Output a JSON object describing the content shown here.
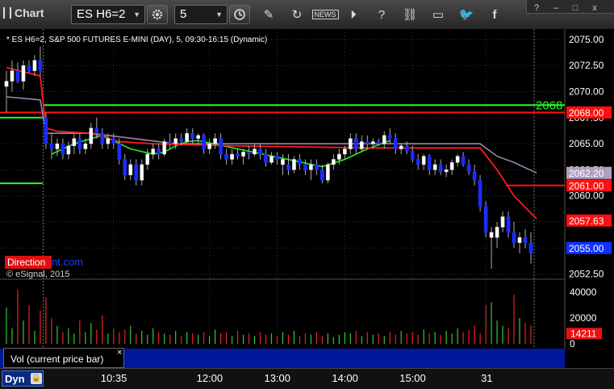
{
  "toolbar": {
    "app_title": "Chart",
    "symbol_value": "ES H6=2",
    "interval_value": "5"
  },
  "window_controls": [
    "?",
    "–",
    "□",
    "x"
  ],
  "chart_header": "* ES H6=2, S&P 500 FUTURES E-MINI (DAY), 5, 09:30-16:15 (Dynamic)",
  "watermark": {
    "part1": "Direction",
    "part2": "nt.com"
  },
  "copyright": "© eSignal, 2015",
  "price_labels": [
    {
      "value": 2068.0,
      "text": "2068.00",
      "color": "#ff1010"
    },
    {
      "value": 2062.2,
      "text": "2062.20",
      "color": "#b0a0c0"
    },
    {
      "value": 2061.0,
      "text": "2061.00",
      "color": "#ff1010"
    },
    {
      "value": 2057.63,
      "text": "2057.63",
      "color": "#ff1010"
    },
    {
      "value": 2055.0,
      "text": "2055.00",
      "color": "#1030ff"
    }
  ],
  "level_label": {
    "value": 2068.7,
    "text": "2068",
    "color": "#22ff22"
  },
  "volume_label": "Vol (current price bar)",
  "volume_last_label": "14211",
  "dyn_button": "Dyn",
  "chart_data": {
    "type": "candlestick",
    "price_axis": {
      "ticks": [
        "2075.00",
        "2072.50",
        "2070.00",
        "2067.50",
        "2065.00",
        "2062.50",
        "2060.00",
        "2057.50",
        "2055.00",
        "2052.50"
      ],
      "ylim": [
        2052.0,
        2076.0
      ]
    },
    "time_axis": {
      "ticks": [
        "10:35",
        "12:00",
        "13:00",
        "14:00",
        "15:00",
        "31"
      ]
    },
    "volume_axis": {
      "ticks": [
        "40000",
        "20000",
        "0"
      ],
      "ylim": [
        0,
        45000
      ]
    },
    "candles": [
      {
        "o": 2070.5,
        "h": 2072.0,
        "l": 2068.0,
        "c": 2071.0,
        "up": true
      },
      {
        "o": 2071.0,
        "h": 2073.0,
        "l": 2070.0,
        "c": 2072.0,
        "up": true
      },
      {
        "o": 2072.0,
        "h": 2072.8,
        "l": 2070.8,
        "c": 2071.0,
        "up": false
      },
      {
        "o": 2071.0,
        "h": 2073.0,
        "l": 2070.2,
        "c": 2072.5,
        "up": true
      },
      {
        "o": 2072.5,
        "h": 2073.0,
        "l": 2071.8,
        "c": 2072.0,
        "up": false
      },
      {
        "o": 2072.0,
        "h": 2073.5,
        "l": 2071.5,
        "c": 2073.0,
        "up": true
      },
      {
        "o": 2073.0,
        "h": 2074.3,
        "l": 2071.5,
        "c": 2072.0,
        "up": false
      },
      {
        "o": 2067.5,
        "h": 2068.0,
        "l": 2064.5,
        "c": 2065.0,
        "up": false
      },
      {
        "o": 2065.0,
        "h": 2066.0,
        "l": 2063.5,
        "c": 2064.5,
        "up": false
      },
      {
        "o": 2064.5,
        "h": 2065.5,
        "l": 2063.8,
        "c": 2065.0,
        "up": true
      },
      {
        "o": 2065.0,
        "h": 2065.5,
        "l": 2063.5,
        "c": 2064.0,
        "up": false
      },
      {
        "o": 2064.0,
        "h": 2065.2,
        "l": 2063.5,
        "c": 2064.8,
        "up": true
      },
      {
        "o": 2064.8,
        "h": 2066.0,
        "l": 2064.0,
        "c": 2065.5,
        "up": true
      },
      {
        "o": 2065.5,
        "h": 2066.0,
        "l": 2064.0,
        "c": 2064.5,
        "up": false
      },
      {
        "o": 2064.5,
        "h": 2065.5,
        "l": 2064.0,
        "c": 2065.0,
        "up": true
      },
      {
        "o": 2065.0,
        "h": 2067.0,
        "l": 2064.5,
        "c": 2066.5,
        "up": true
      },
      {
        "o": 2066.5,
        "h": 2067.5,
        "l": 2065.5,
        "c": 2066.0,
        "up": false
      },
      {
        "o": 2066.0,
        "h": 2066.5,
        "l": 2064.5,
        "c": 2065.0,
        "up": false
      },
      {
        "o": 2065.0,
        "h": 2066.0,
        "l": 2064.5,
        "c": 2065.5,
        "up": true
      },
      {
        "o": 2065.5,
        "h": 2066.0,
        "l": 2064.5,
        "c": 2065.0,
        "up": false
      },
      {
        "o": 2065.0,
        "h": 2065.5,
        "l": 2063.0,
        "c": 2063.5,
        "up": false
      },
      {
        "o": 2063.5,
        "h": 2064.0,
        "l": 2061.5,
        "c": 2062.0,
        "up": false
      },
      {
        "o": 2062.0,
        "h": 2063.5,
        "l": 2061.5,
        "c": 2063.0,
        "up": true
      },
      {
        "o": 2063.0,
        "h": 2063.5,
        "l": 2061.0,
        "c": 2061.5,
        "up": false
      },
      {
        "o": 2061.5,
        "h": 2063.5,
        "l": 2061.0,
        "c": 2063.0,
        "up": true
      },
      {
        "o": 2063.0,
        "h": 2064.5,
        "l": 2062.5,
        "c": 2064.0,
        "up": true
      },
      {
        "o": 2064.0,
        "h": 2065.0,
        "l": 2063.5,
        "c": 2064.5,
        "up": true
      },
      {
        "o": 2064.5,
        "h": 2065.0,
        "l": 2063.5,
        "c": 2064.0,
        "up": false
      },
      {
        "o": 2064.0,
        "h": 2065.5,
        "l": 2063.8,
        "c": 2065.2,
        "up": true
      },
      {
        "o": 2065.2,
        "h": 2066.0,
        "l": 2064.5,
        "c": 2065.0,
        "up": false
      },
      {
        "o": 2065.0,
        "h": 2066.0,
        "l": 2064.5,
        "c": 2065.5,
        "up": true
      },
      {
        "o": 2065.5,
        "h": 2066.0,
        "l": 2064.8,
        "c": 2065.2,
        "up": false
      },
      {
        "o": 2065.2,
        "h": 2066.5,
        "l": 2065.0,
        "c": 2066.0,
        "up": true
      },
      {
        "o": 2066.0,
        "h": 2066.5,
        "l": 2065.0,
        "c": 2065.5,
        "up": false
      },
      {
        "o": 2065.5,
        "h": 2066.0,
        "l": 2065.0,
        "c": 2065.8,
        "up": true
      },
      {
        "o": 2065.8,
        "h": 2066.0,
        "l": 2064.0,
        "c": 2064.5,
        "up": false
      },
      {
        "o": 2064.5,
        "h": 2065.5,
        "l": 2064.0,
        "c": 2065.0,
        "up": true
      },
      {
        "o": 2065.0,
        "h": 2066.0,
        "l": 2064.5,
        "c": 2065.5,
        "up": true
      },
      {
        "o": 2065.5,
        "h": 2066.0,
        "l": 2063.5,
        "c": 2064.0,
        "up": false
      },
      {
        "o": 2064.0,
        "h": 2064.5,
        "l": 2063.0,
        "c": 2063.5,
        "up": false
      },
      {
        "o": 2063.5,
        "h": 2064.5,
        "l": 2063.0,
        "c": 2064.0,
        "up": true
      },
      {
        "o": 2064.0,
        "h": 2064.5,
        "l": 2063.5,
        "c": 2063.8,
        "up": false
      },
      {
        "o": 2063.8,
        "h": 2064.5,
        "l": 2063.0,
        "c": 2064.2,
        "up": true
      },
      {
        "o": 2064.2,
        "h": 2064.8,
        "l": 2063.5,
        "c": 2064.0,
        "up": false
      },
      {
        "o": 2064.0,
        "h": 2065.0,
        "l": 2063.8,
        "c": 2064.5,
        "up": true
      },
      {
        "o": 2064.5,
        "h": 2065.0,
        "l": 2063.5,
        "c": 2064.0,
        "up": false
      },
      {
        "o": 2064.0,
        "h": 2064.5,
        "l": 2062.8,
        "c": 2063.2,
        "up": false
      },
      {
        "o": 2063.2,
        "h": 2064.2,
        "l": 2063.0,
        "c": 2063.8,
        "up": true
      },
      {
        "o": 2063.8,
        "h": 2064.2,
        "l": 2063.0,
        "c": 2063.5,
        "up": false
      },
      {
        "o": 2063.5,
        "h": 2064.0,
        "l": 2062.0,
        "c": 2063.0,
        "up": true
      },
      {
        "o": 2063.0,
        "h": 2064.0,
        "l": 2062.0,
        "c": 2062.5,
        "up": false
      },
      {
        "o": 2062.5,
        "h": 2063.8,
        "l": 2062.2,
        "c": 2063.5,
        "up": true
      },
      {
        "o": 2063.5,
        "h": 2064.0,
        "l": 2062.5,
        "c": 2063.0,
        "up": false
      },
      {
        "o": 2063.0,
        "h": 2063.5,
        "l": 2062.0,
        "c": 2062.5,
        "up": false
      },
      {
        "o": 2062.5,
        "h": 2063.5,
        "l": 2061.5,
        "c": 2063.0,
        "up": true
      },
      {
        "o": 2063.0,
        "h": 2063.5,
        "l": 2062.0,
        "c": 2062.5,
        "up": false
      },
      {
        "o": 2062.5,
        "h": 2063.0,
        "l": 2061.2,
        "c": 2061.5,
        "up": false
      },
      {
        "o": 2061.5,
        "h": 2063.2,
        "l": 2061.2,
        "c": 2063.0,
        "up": true
      },
      {
        "o": 2063.0,
        "h": 2064.0,
        "l": 2062.5,
        "c": 2063.5,
        "up": true
      },
      {
        "o": 2063.5,
        "h": 2064.5,
        "l": 2063.0,
        "c": 2064.0,
        "up": true
      },
      {
        "o": 2064.0,
        "h": 2064.8,
        "l": 2063.5,
        "c": 2064.5,
        "up": true
      },
      {
        "o": 2064.5,
        "h": 2066.0,
        "l": 2064.0,
        "c": 2065.5,
        "up": true
      },
      {
        "o": 2065.5,
        "h": 2066.0,
        "l": 2064.0,
        "c": 2064.5,
        "up": false
      },
      {
        "o": 2064.5,
        "h": 2065.8,
        "l": 2064.2,
        "c": 2065.2,
        "up": true
      },
      {
        "o": 2065.2,
        "h": 2065.8,
        "l": 2064.5,
        "c": 2065.0,
        "up": false
      },
      {
        "o": 2065.0,
        "h": 2065.5,
        "l": 2064.5,
        "c": 2065.2,
        "up": true
      },
      {
        "o": 2065.2,
        "h": 2065.5,
        "l": 2064.8,
        "c": 2065.0,
        "up": false
      },
      {
        "o": 2065.0,
        "h": 2066.2,
        "l": 2064.5,
        "c": 2065.8,
        "up": true
      },
      {
        "o": 2065.8,
        "h": 2066.5,
        "l": 2065.0,
        "c": 2065.5,
        "up": false
      },
      {
        "o": 2065.5,
        "h": 2066.0,
        "l": 2064.0,
        "c": 2064.5,
        "up": false
      },
      {
        "o": 2064.5,
        "h": 2065.0,
        "l": 2064.0,
        "c": 2064.8,
        "up": true
      },
      {
        "o": 2064.8,
        "h": 2065.2,
        "l": 2064.0,
        "c": 2064.3,
        "up": false
      },
      {
        "o": 2064.3,
        "h": 2064.8,
        "l": 2063.2,
        "c": 2063.5,
        "up": false
      },
      {
        "o": 2063.5,
        "h": 2064.0,
        "l": 2062.5,
        "c": 2063.0,
        "up": false
      },
      {
        "o": 2063.0,
        "h": 2064.0,
        "l": 2062.5,
        "c": 2063.8,
        "up": true
      },
      {
        "o": 2063.8,
        "h": 2064.0,
        "l": 2062.0,
        "c": 2062.5,
        "up": false
      },
      {
        "o": 2062.5,
        "h": 2063.5,
        "l": 2062.0,
        "c": 2063.0,
        "up": true
      },
      {
        "o": 2063.0,
        "h": 2063.5,
        "l": 2062.0,
        "c": 2062.3,
        "up": false
      },
      {
        "o": 2062.3,
        "h": 2063.0,
        "l": 2061.8,
        "c": 2062.5,
        "up": true
      },
      {
        "o": 2062.5,
        "h": 2063.5,
        "l": 2062.0,
        "c": 2063.2,
        "up": true
      },
      {
        "o": 2063.2,
        "h": 2064.0,
        "l": 2062.8,
        "c": 2063.8,
        "up": true
      },
      {
        "o": 2063.8,
        "h": 2064.2,
        "l": 2062.8,
        "c": 2063.0,
        "up": false
      },
      {
        "o": 2063.0,
        "h": 2063.5,
        "l": 2062.0,
        "c": 2062.3,
        "up": false
      },
      {
        "o": 2062.3,
        "h": 2063.0,
        "l": 2061.0,
        "c": 2061.5,
        "up": false
      },
      {
        "o": 2061.5,
        "h": 2062.0,
        "l": 2058.5,
        "c": 2059.0,
        "up": false
      },
      {
        "o": 2059.0,
        "h": 2059.5,
        "l": 2056.0,
        "c": 2056.5,
        "up": false
      },
      {
        "o": 2056.5,
        "h": 2057.0,
        "l": 2053.0,
        "c": 2056.0,
        "up": true
      },
      {
        "o": 2056.0,
        "h": 2057.5,
        "l": 2055.0,
        "c": 2057.0,
        "up": true
      },
      {
        "o": 2057.0,
        "h": 2058.5,
        "l": 2056.5,
        "c": 2058.0,
        "up": true
      },
      {
        "o": 2058.0,
        "h": 2058.5,
        "l": 2056.0,
        "c": 2056.5,
        "up": false
      },
      {
        "o": 2056.5,
        "h": 2057.5,
        "l": 2055.0,
        "c": 2055.5,
        "up": false
      },
      {
        "o": 2055.5,
        "h": 2056.5,
        "l": 2054.5,
        "c": 2056.0,
        "up": true
      },
      {
        "o": 2056.0,
        "h": 2056.8,
        "l": 2055.0,
        "c": 2055.5,
        "up": false
      },
      {
        "o": 2055.5,
        "h": 2056.5,
        "l": 2053.5,
        "c": 2054.5,
        "up": false
      }
    ],
    "volumes": [
      28000,
      12000,
      42000,
      18000,
      30000,
      10000,
      26000,
      36000,
      20000,
      14000,
      9000,
      12000,
      8000,
      18000,
      9000,
      16000,
      11000,
      22000,
      8000,
      12000,
      9000,
      11000,
      14000,
      8000,
      10000,
      7000,
      12000,
      9000,
      8000,
      7000,
      10000,
      6000,
      9000,
      8000,
      7000,
      9000,
      6000,
      11000,
      8000,
      9000,
      6000,
      10000,
      7000,
      8000,
      6000,
      9000,
      7000,
      8000,
      6000,
      9000,
      7000,
      10000,
      6000,
      8000,
      7000,
      9000,
      6000,
      8000,
      5000,
      7000,
      9000,
      8000,
      10000,
      6000,
      9000,
      7000,
      8000,
      6000,
      9000,
      7000,
      10000,
      8000,
      9000,
      7000,
      11000,
      8000,
      9000,
      7000,
      10000,
      8000,
      12000,
      9000,
      11000,
      14000,
      8000,
      30000,
      32000,
      18000,
      14000,
      12000,
      38000,
      20000,
      16000,
      14211
    ],
    "ma_red": [
      {
        "i": 0,
        "v": 2072.3
      },
      {
        "i": 6,
        "v": 2071.5
      },
      {
        "i": 7,
        "v": 2066.5
      },
      {
        "i": 9,
        "v": 2066.2
      },
      {
        "i": 15,
        "v": 2066.0
      },
      {
        "i": 20,
        "v": 2065.2
      },
      {
        "i": 26,
        "v": 2065.0
      },
      {
        "i": 40,
        "v": 2064.8
      },
      {
        "i": 65,
        "v": 2064.6
      },
      {
        "i": 84,
        "v": 2064.6
      },
      {
        "i": 87,
        "v": 2062.5
      },
      {
        "i": 90,
        "v": 2060.0
      },
      {
        "i": 94,
        "v": 2057.8
      }
    ],
    "ma_purple": [
      {
        "i": 0,
        "v": 2069.5
      },
      {
        "i": 6,
        "v": 2069.2
      },
      {
        "i": 7,
        "v": 2066.0
      },
      {
        "i": 15,
        "v": 2066.0
      },
      {
        "i": 30,
        "v": 2065.0
      },
      {
        "i": 84,
        "v": 2065.0
      },
      {
        "i": 87,
        "v": 2063.8
      },
      {
        "i": 90,
        "v": 2063.2
      },
      {
        "i": 94,
        "v": 2062.2
      }
    ],
    "ma_green": [
      {
        "i": 8,
        "v": 2064.0
      },
      {
        "i": 12,
        "v": 2065.0
      },
      {
        "i": 17,
        "v": 2065.8
      },
      {
        "i": 22,
        "v": 2064.5
      },
      {
        "i": 26,
        "v": 2064.0
      },
      {
        "i": 28,
        "v": 2064.2
      },
      {
        "i": 30,
        "v": 2064.8
      },
      {
        "i": 32,
        "v": 2065.2
      },
      {
        "i": 34,
        "v": 2065.3
      },
      {
        "i": 56,
        "v": 2062.8
      },
      {
        "i": 60,
        "v": 2063.5
      },
      {
        "i": 64,
        "v": 2064.5
      },
      {
        "i": 68,
        "v": 2065.3
      }
    ],
    "levels": [
      {
        "value": 2068.7,
        "color": "#22ff22",
        "from": 7,
        "to": 94
      },
      {
        "value": 2068.0,
        "color": "#ff1010",
        "from": 0,
        "to": 94
      },
      {
        "value": 2061.0,
        "color": "#ff1010",
        "from": 89,
        "to": 94
      },
      {
        "value": 2067.5,
        "color": "#22ff22",
        "from": 0,
        "to": 6
      },
      {
        "value": 2061.2,
        "color": "#22ff22",
        "from": 0,
        "to": 6
      }
    ],
    "session_break_index": 6.5,
    "time_ticks_index": [
      {
        "label": "10:35",
        "i": 19
      },
      {
        "label": "12:00",
        "i": 36
      },
      {
        "label": "13:00",
        "i": 48
      },
      {
        "label": "14:00",
        "i": 60
      },
      {
        "label": "15:00",
        "i": 72
      },
      {
        "label": "31",
        "i": 85
      }
    ]
  }
}
